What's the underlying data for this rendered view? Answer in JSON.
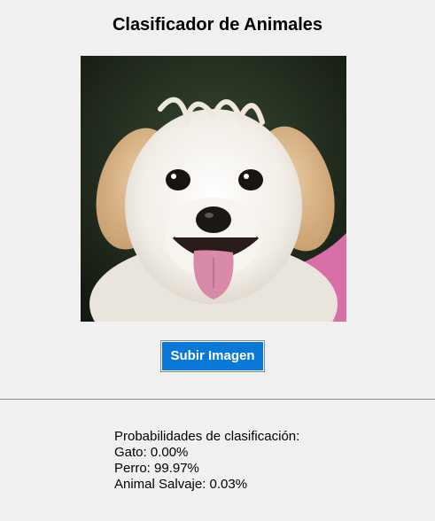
{
  "app": {
    "title": "Clasificador de Animales"
  },
  "image": {
    "subject": "dog-photo"
  },
  "controls": {
    "upload_label": "Subir Imagen",
    "upload_color": "#0a78d7"
  },
  "results": {
    "heading": "Probabilidades de clasificación:",
    "cat": "Gato: 0.00%",
    "dog": "Perro: 99.97%",
    "wild": "Animal Salvaje: 0.03%"
  }
}
